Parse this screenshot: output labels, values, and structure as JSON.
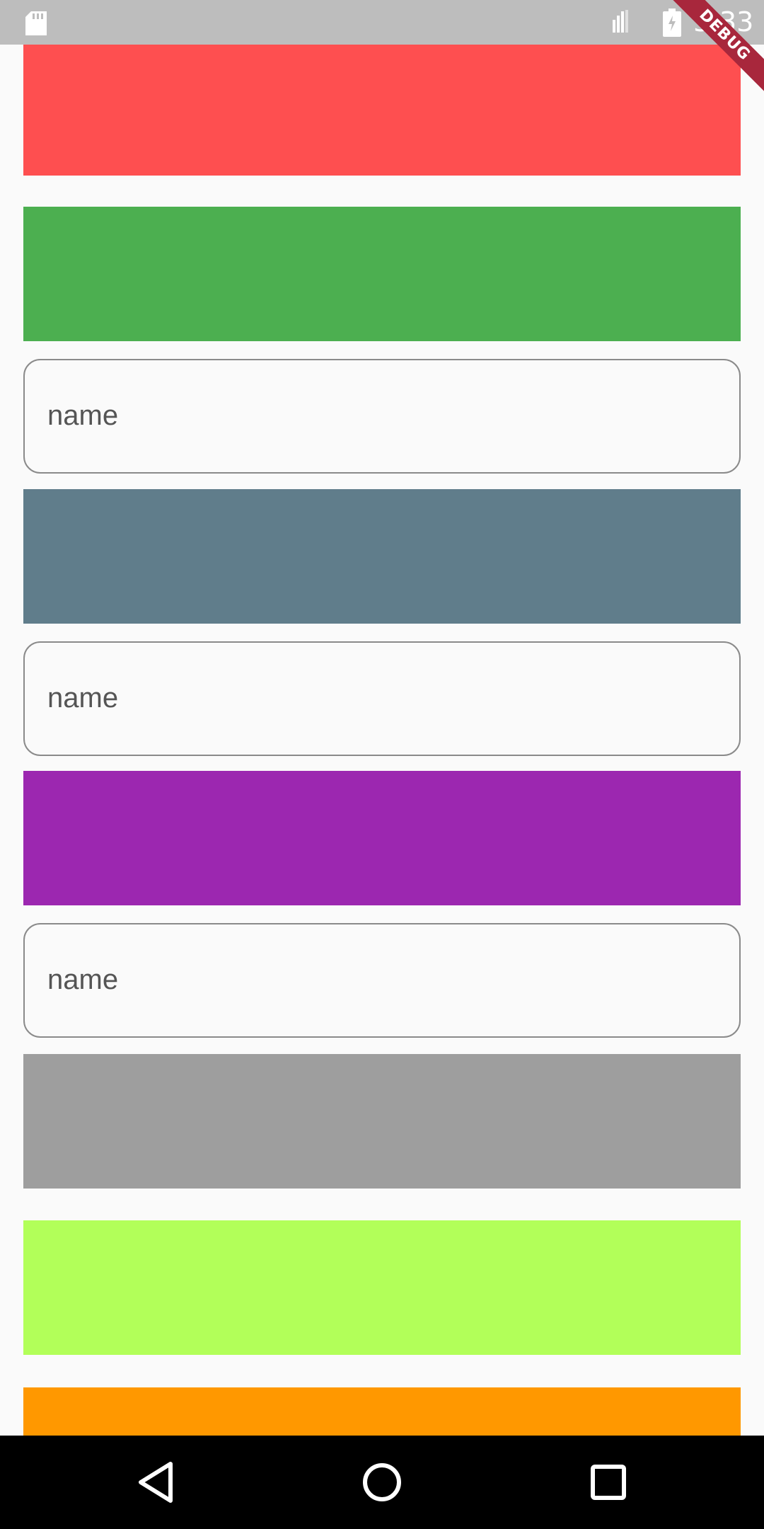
{
  "status_bar": {
    "time": "3:33",
    "left_icon": "sd-card-icon",
    "signal_icon": "signal-icon",
    "battery_icon": "battery-charging-icon",
    "background": "#bdbdbd"
  },
  "debug_banner": {
    "text": "DEBUG",
    "color": "#a8273c"
  },
  "list": {
    "items": [
      {
        "type": "color",
        "color": "#fe4f50"
      },
      {
        "type": "color",
        "color": "#4caf50"
      },
      {
        "type": "field",
        "label": "name"
      },
      {
        "type": "color",
        "color": "#607d8b"
      },
      {
        "type": "field",
        "label": "name"
      },
      {
        "type": "color",
        "color": "#9c27b0"
      },
      {
        "type": "field",
        "label": "name"
      },
      {
        "type": "color",
        "color": "#9e9e9e"
      },
      {
        "type": "color",
        "color": "#b2ff59"
      },
      {
        "type": "color",
        "color": "#ff9800"
      }
    ]
  },
  "nav_bar": {
    "back_icon": "back-triangle-icon",
    "home_icon": "home-circle-icon",
    "recents_icon": "recents-square-icon"
  }
}
